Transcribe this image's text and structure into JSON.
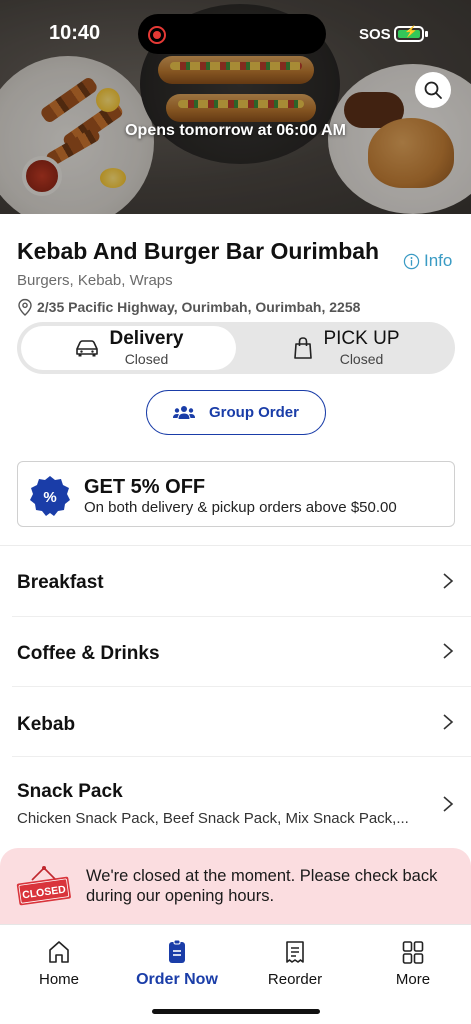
{
  "status_bar": {
    "time": "10:40",
    "sos": "SOS"
  },
  "hero": {
    "note": "Opens tomorrow at 06:00 AM",
    "search_icon": "search-icon"
  },
  "store": {
    "name": "Kebab And Burger Bar Ourimbah",
    "info_label": "Info",
    "cuisines": "Burgers, Kebab, Wraps",
    "address": "2/35 Pacific Highway, Ourimbah, Ourimbah, 2258"
  },
  "order_mode": {
    "delivery": {
      "label": "Delivery",
      "status": "Closed",
      "selected": true
    },
    "pickup": {
      "label": "PICK UP",
      "status": "Closed",
      "selected": false
    }
  },
  "group_order_label": "Group Order",
  "promo": {
    "badge_symbol": "%",
    "title": "GET 5% OFF",
    "description": "On both delivery & pickup orders above $50.00"
  },
  "menu": [
    {
      "title": "Breakfast",
      "subtitle": ""
    },
    {
      "title": "Coffee & Drinks",
      "subtitle": ""
    },
    {
      "title": "Kebab",
      "subtitle": ""
    },
    {
      "title": "Snack Pack",
      "subtitle": "Chicken Snack Pack, Beef Snack Pack, Mix Snack Pack,..."
    }
  ],
  "closed_notice": {
    "sign_text": "CLOSED",
    "message": "We're closed at the moment. Please check back during our opening hours."
  },
  "tabs": [
    {
      "label": "Home",
      "icon": "home-icon",
      "active": false
    },
    {
      "label": "Order Now",
      "icon": "order-icon",
      "active": true
    },
    {
      "label": "Reorder",
      "icon": "receipt-icon",
      "active": false
    },
    {
      "label": "More",
      "icon": "grid-icon",
      "active": false
    }
  ],
  "colors": {
    "accent": "#1a3da8",
    "info": "#3a9bc4",
    "closed_banner": "#fbdde0",
    "closed_sign": "#d9343b",
    "battery": "#34c759"
  }
}
